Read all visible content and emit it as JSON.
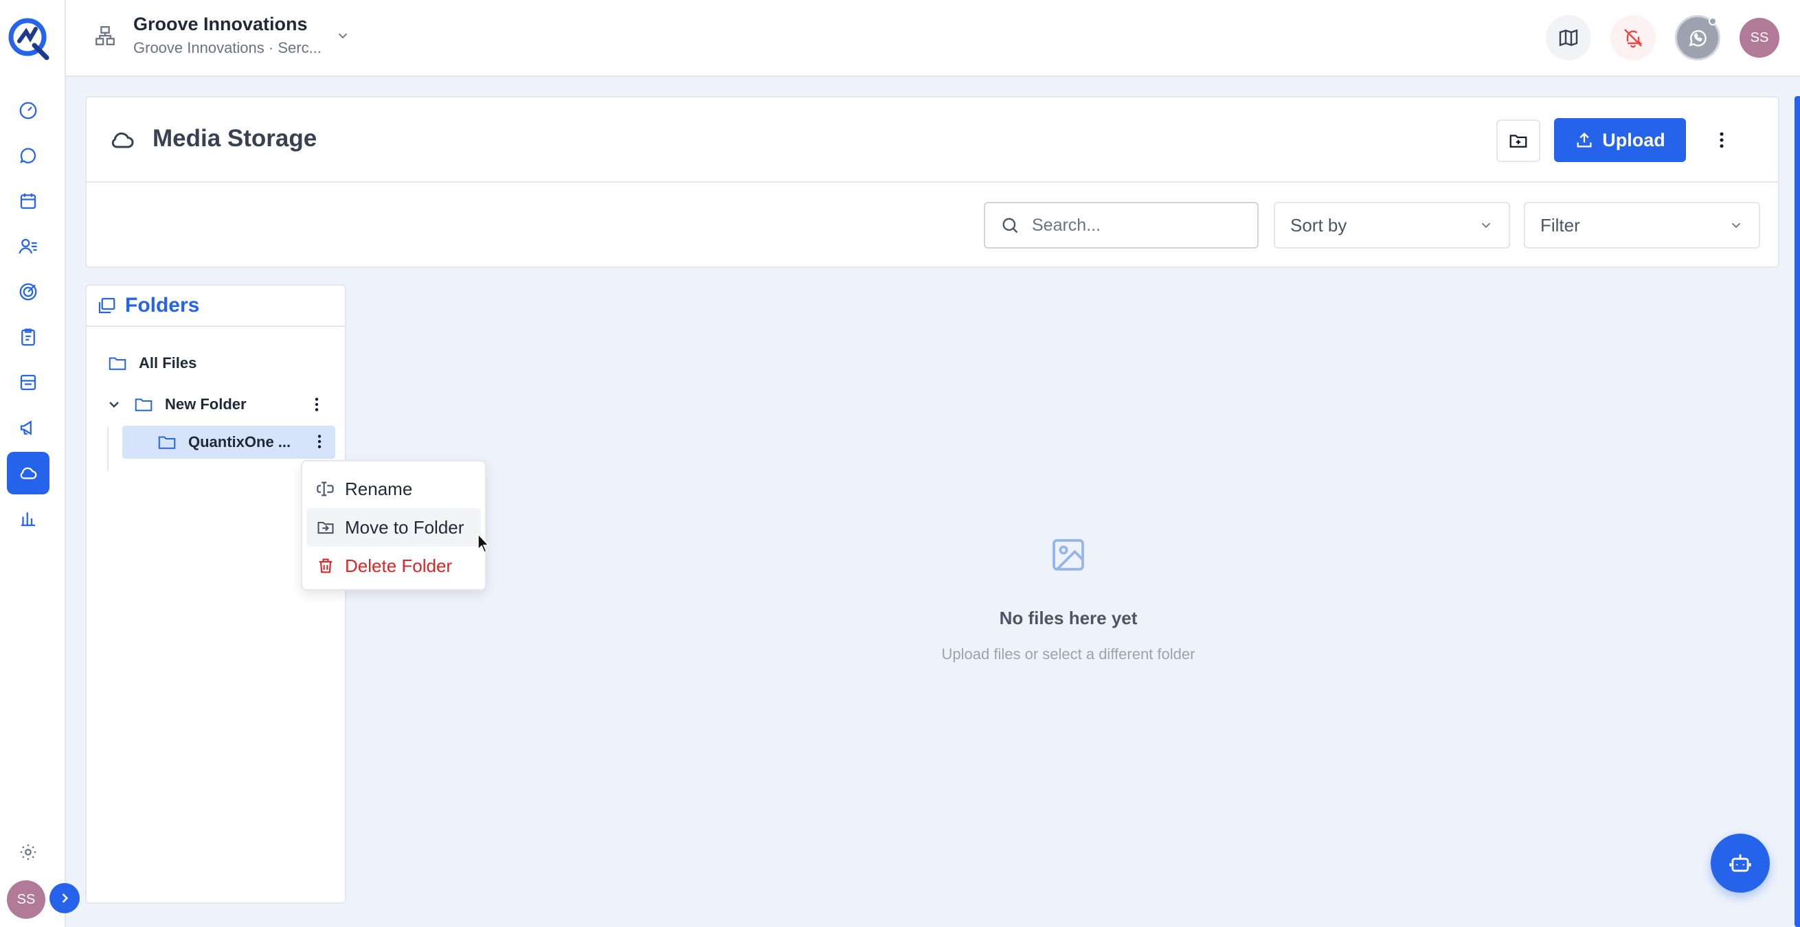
{
  "org": {
    "name": "Groove Innovations",
    "subtitle": "Groove Innovations · Serc..."
  },
  "topbar": {
    "avatar_initials": "SS"
  },
  "rail": {
    "avatar_initials": "SS"
  },
  "page": {
    "title": "Media Storage",
    "upload_label": "Upload"
  },
  "toolbar": {
    "search_placeholder": "Search...",
    "sort_label": "Sort by",
    "filter_label": "Filter"
  },
  "folders": {
    "title": "Folders",
    "all_files": "All Files",
    "new_folder": "New Folder",
    "sub_folder": "QuantixOne ..."
  },
  "context_menu": {
    "rename": "Rename",
    "move": "Move to Folder",
    "delete": "Delete Folder"
  },
  "empty": {
    "title": "No files here yet",
    "subtitle": "Upload files or select a different folder"
  },
  "colors": {
    "accent": "#2563eb",
    "danger": "#dc2626",
    "avatar": "#b07a98"
  }
}
